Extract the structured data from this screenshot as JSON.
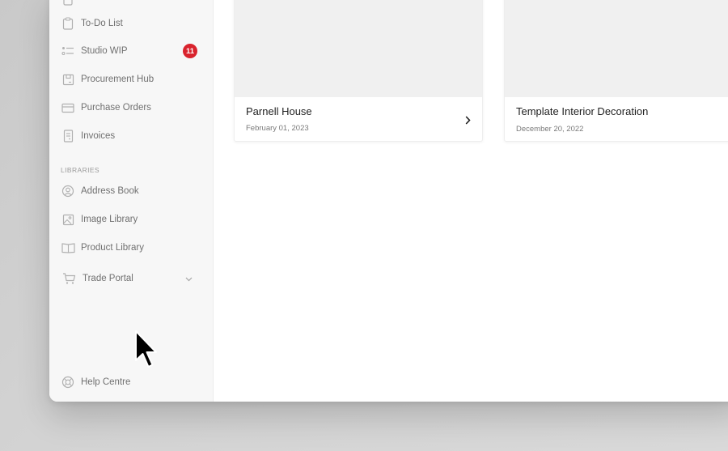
{
  "sidebar": {
    "items": [
      {
        "label": "To-Do List",
        "icon": "clipboard-icon"
      },
      {
        "label": "Studio WIP",
        "icon": "list-icon",
        "badge": "11"
      },
      {
        "label": "Procurement Hub",
        "icon": "box-icon"
      },
      {
        "label": "Purchase Orders",
        "icon": "card-icon"
      },
      {
        "label": "Invoices",
        "icon": "invoice-icon"
      }
    ],
    "libraries_title": "LIBRARIES",
    "libraries": [
      {
        "label": "Address Book",
        "icon": "user-circle-icon"
      },
      {
        "label": "Image Library",
        "icon": "image-icon"
      },
      {
        "label": "Product Library",
        "icon": "book-icon"
      },
      {
        "label": "Trade Portal",
        "icon": "cart-icon"
      }
    ],
    "help": {
      "label": "Help Centre",
      "icon": "lifebuoy-icon"
    }
  },
  "projects": [
    {
      "title": "Parnell House",
      "date": "February 01, 2023"
    },
    {
      "title": "Template Interior Decoration",
      "date": "December 20, 2022"
    }
  ],
  "colors": {
    "badge": "#d9232d",
    "sidebar_bg": "#f7f7f7",
    "thumb_bg": "#f0f0f0"
  }
}
